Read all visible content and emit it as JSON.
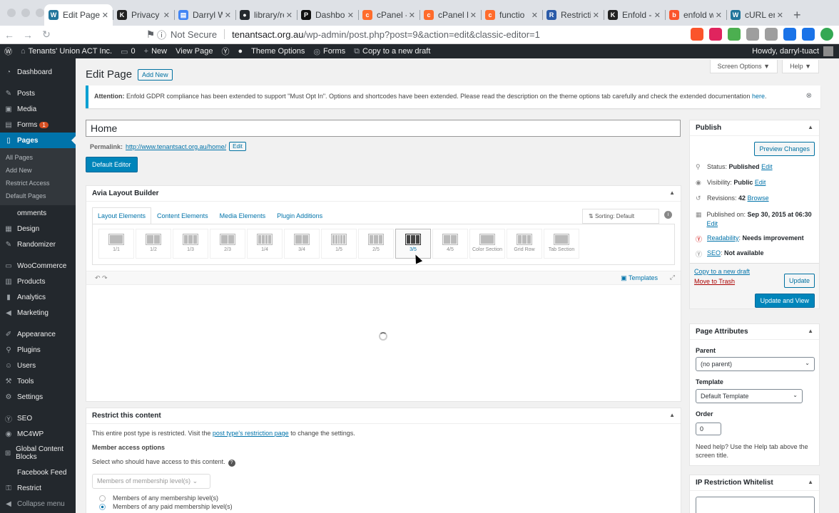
{
  "browser": {
    "tabs": [
      {
        "title": "Edit Page",
        "fav_color": "#21759b",
        "fav_glyph": "W",
        "active": true
      },
      {
        "title": "Privacy &",
        "fav_color": "#222222",
        "fav_glyph": "K"
      },
      {
        "title": "Darryl W",
        "fav_color": "#4285f4",
        "fav_glyph": "▤"
      },
      {
        "title": "library/re",
        "fav_color": "#24292e",
        "fav_glyph": "●"
      },
      {
        "title": "Dashboa",
        "fav_color": "#111111",
        "fav_glyph": "P"
      },
      {
        "title": "cPanel -",
        "fav_color": "#ff6c2c",
        "fav_glyph": "c"
      },
      {
        "title": "cPanel F",
        "fav_color": "#ff6c2c",
        "fav_glyph": "c"
      },
      {
        "title": "functio",
        "fav_color": "#ff6c2c",
        "fav_glyph": "c"
      },
      {
        "title": "Restricti",
        "fav_color": "#2b5ba8",
        "fav_glyph": "R"
      },
      {
        "title": "Enfold -",
        "fav_color": "#222222",
        "fav_glyph": "K"
      },
      {
        "title": "enfold w",
        "fav_color": "#fb542b",
        "fav_glyph": "b"
      },
      {
        "title": "cURL err",
        "fav_color": "#21759b",
        "fav_glyph": "W"
      }
    ],
    "new_tab": "+",
    "not_secure": "Not Secure",
    "url_host": "tenantsact.org.au",
    "url_path": "/wp-admin/post.php?post=9&action=edit&classic-editor=1"
  },
  "adminbar": {
    "site_name": "Tenants' Union ACT Inc.",
    "comments_count": "0",
    "new_label": "New",
    "view_page": "View Page",
    "theme_options": "Theme Options",
    "forms": "Forms",
    "copy_draft": "Copy to a new draft",
    "howdy": "Howdy, darryl-tuact"
  },
  "sidebar": {
    "dashboard": "Dashboard",
    "posts": "Posts",
    "media": "Media",
    "forms": "Forms",
    "forms_badge": "1",
    "pages": "Pages",
    "sub": [
      "All Pages",
      "Add New",
      "Restrict Access",
      "Default Pages"
    ],
    "comments": "omments",
    "design": "Design",
    "randomizer": "Randomizer",
    "woocommerce": "WooCommerce",
    "products": "Products",
    "analytics": "Analytics",
    "marketing": "Marketing",
    "appearance": "Appearance",
    "plugins": "Plugins",
    "users": "Users",
    "tools": "Tools",
    "settings": "Settings",
    "seo": "SEO",
    "mc4wp": "MC4WP",
    "global_blocks": "Global Content Blocks",
    "facebook_feed": "Facebook Feed",
    "restrict": "Restrict",
    "collapse": "Collapse menu"
  },
  "main": {
    "screen_options": "Screen Options ▼",
    "help": "Help ▼",
    "title": "Edit Page",
    "add_new": "Add New",
    "notice_label": "Attention:",
    "notice_text": " Enfold GDPR compliance has been extended to support \"Must Opt In\". Options and shortcodes have been extended. Please read the description on the theme options tab carefully and check the extended documentation ",
    "notice_link": "here",
    "notice_end": ".",
    "post_title": "Home",
    "permalink_label": "Permalink:",
    "permalink_url": "http://www.tenantsact.org.au/home/",
    "permalink_edit": "Edit",
    "default_editor": "Default Editor"
  },
  "avia": {
    "title": "Avia Layout Builder",
    "tabs": [
      "Layout Elements",
      "Content Elements",
      "Media Elements",
      "Plugin Additions"
    ],
    "sorting": "Sorting: Default",
    "elements": [
      {
        "label": "1/1",
        "cols": 1
      },
      {
        "label": "1/2",
        "cols": 2
      },
      {
        "label": "1/3",
        "cols": 3
      },
      {
        "label": "2/3",
        "cols": 2
      },
      {
        "label": "1/4",
        "cols": 4
      },
      {
        "label": "3/4",
        "cols": 2
      },
      {
        "label": "1/5",
        "cols": 5
      },
      {
        "label": "2/5",
        "cols": 3
      },
      {
        "label": "3/5",
        "cols": 3
      },
      {
        "label": "4/5",
        "cols": 2
      },
      {
        "label": "Color Section",
        "cols": 1
      },
      {
        "label": "Grid Row",
        "cols": 3
      },
      {
        "label": "Tab Section",
        "cols": 1
      }
    ],
    "hovered_index": 8,
    "templates": "Templates"
  },
  "restrict": {
    "title": "Restrict this content",
    "intro_before": "This entire post type is restricted. Visit the ",
    "intro_link": "post type's restriction page",
    "intro_after": " to change the settings.",
    "member_options": "Member access options",
    "select_who": "Select who should have access to this content.",
    "select_value": "Members of membership level(s)",
    "radio1": "Members of any membership level(s)",
    "radio2": "Members of any paid membership level(s)"
  },
  "publish": {
    "title": "Publish",
    "preview": "Preview Changes",
    "status_label": "Status:",
    "status_value": "Published",
    "visibility_label": "Visibility:",
    "visibility_value": "Public",
    "revisions_label": "Revisions:",
    "revisions_value": "42",
    "browse": "Browse",
    "published_label": "Published on:",
    "published_value": "Sep 30, 2015 at 06:30",
    "edit": "Edit",
    "readability_label": "Readability",
    "readability_value": "Needs improvement",
    "seo_label": "SEO",
    "seo_value": "Not available",
    "copy_draft": "Copy to a new draft",
    "trash": "Move to Trash",
    "update": "Update",
    "update_view": "Update and View"
  },
  "attributes": {
    "title": "Page Attributes",
    "parent_label": "Parent",
    "parent_value": "(no parent)",
    "template_label": "Template",
    "template_value": "Default Template",
    "order_label": "Order",
    "order_value": "0",
    "help": "Need help? Use the Help tab above the screen title."
  },
  "ip_restrict": {
    "title": "IP Restriction Whitelist"
  }
}
